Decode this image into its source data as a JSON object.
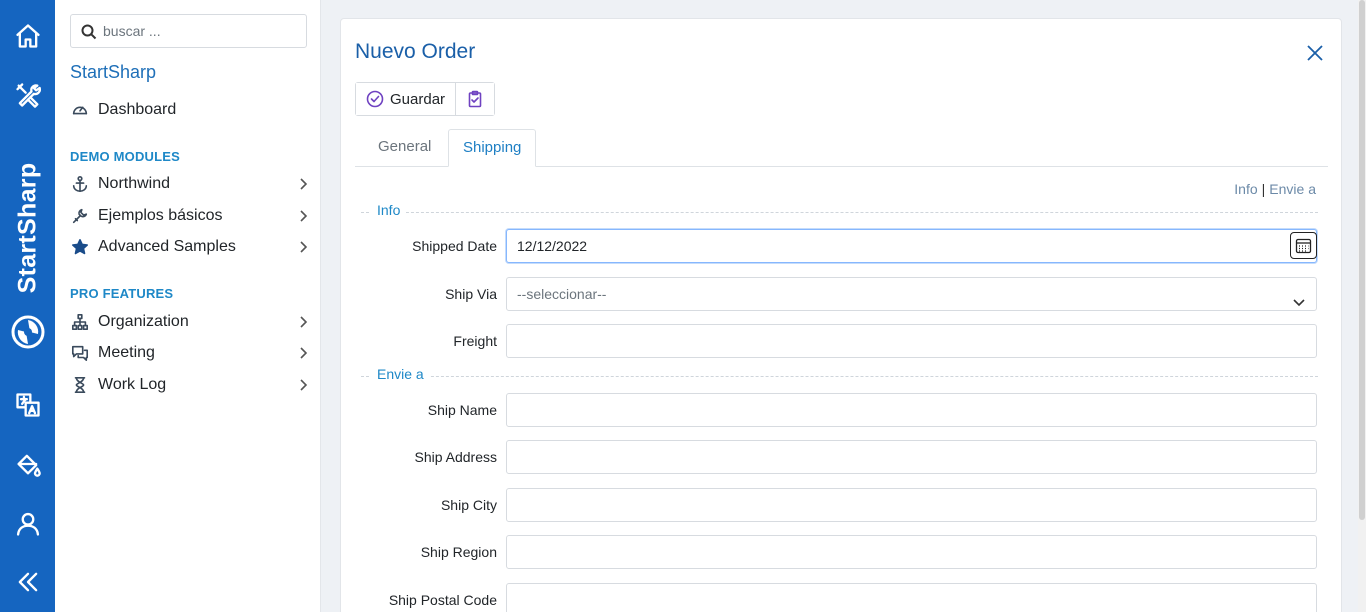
{
  "rail": {
    "brand": "StartSharp",
    "buttons": [
      "home-icon",
      "tools-icon",
      "translate-icon",
      "paint-bucket-icon",
      "user-icon",
      "collapse-icon"
    ]
  },
  "sidebar": {
    "search_placeholder": "buscar ...",
    "title": "StartSharp",
    "dashboard": "Dashboard",
    "sections": {
      "demo": "DEMO MODULES",
      "pro": "PRO FEATURES"
    },
    "demo_items": [
      {
        "label": "Northwind",
        "icon": "anchor-icon"
      },
      {
        "label": "Ejemplos básicos",
        "icon": "wrench-icon"
      },
      {
        "label": "Advanced Samples",
        "icon": "star-icon"
      }
    ],
    "pro_items": [
      {
        "label": "Organization",
        "icon": "org-chart-icon"
      },
      {
        "label": "Meeting",
        "icon": "chat-icon"
      },
      {
        "label": "Work Log",
        "icon": "hourglass-icon"
      }
    ]
  },
  "dialog": {
    "title": "Nuevo Order",
    "toolbar": {
      "save_label": "Guardar"
    },
    "tabs": [
      "General",
      "Shipping"
    ],
    "active_tab": "Shipping",
    "quicklinks": [
      "Info",
      "Envie a"
    ],
    "categories": {
      "info": "Info",
      "envie": "Envie a"
    },
    "fields": {
      "shipped_date": {
        "label": "Shipped Date",
        "value": "12/12/2022"
      },
      "ship_via": {
        "label": "Ship Via",
        "value": "--seleccionar--"
      },
      "freight": {
        "label": "Freight",
        "value": ""
      },
      "ship_name": {
        "label": "Ship Name",
        "value": ""
      },
      "ship_address": {
        "label": "Ship Address",
        "value": ""
      },
      "ship_city": {
        "label": "Ship City",
        "value": ""
      },
      "ship_region": {
        "label": "Ship Region",
        "value": ""
      },
      "ship_postal_code": {
        "label": "Ship Postal Code",
        "value": ""
      }
    }
  },
  "colors": {
    "rail": "#1565c0",
    "accent": "#1e88c7",
    "title": "#1a5fa8"
  }
}
